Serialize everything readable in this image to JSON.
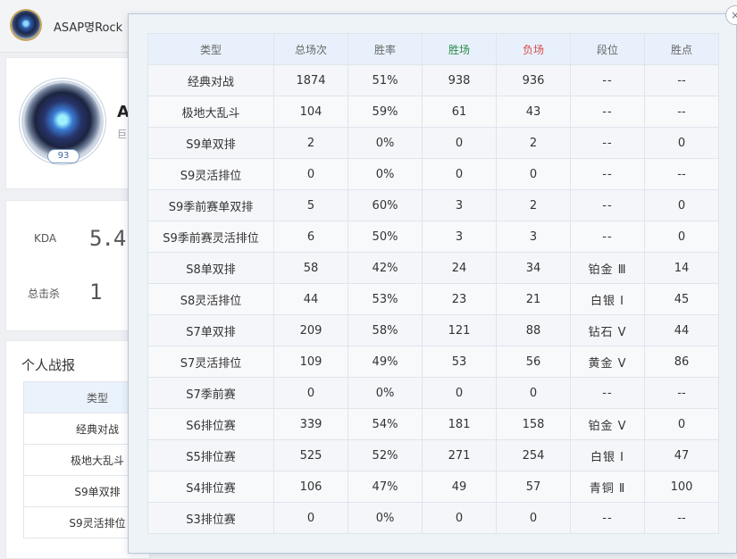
{
  "header": {
    "player_name": "ASAP명Rock"
  },
  "profile": {
    "level": "93",
    "name_initial": "A",
    "sub_initial": "巨"
  },
  "stats": {
    "kda_label": "KDA",
    "kda_value": "5.4",
    "kills_label": "总击杀",
    "kills_value": "1"
  },
  "report": {
    "title": "个人战报",
    "header": "类型",
    "rows": [
      "经典对战",
      "极地大乱斗",
      "S9单双排",
      "S9灵活排位"
    ]
  },
  "popup": {
    "close_label": "×",
    "columns": [
      "类型",
      "总场次",
      "胜率",
      "胜场",
      "负场",
      "段位",
      "胜点"
    ],
    "rows": [
      [
        "经典对战",
        "1874",
        "51%",
        "938",
        "936",
        "--",
        "--"
      ],
      [
        "极地大乱斗",
        "104",
        "59%",
        "61",
        "43",
        "--",
        "--"
      ],
      [
        "S9单双排",
        "2",
        "0%",
        "0",
        "2",
        "--",
        "0"
      ],
      [
        "S9灵活排位",
        "0",
        "0%",
        "0",
        "0",
        "--",
        "--"
      ],
      [
        "S9季前赛单双排",
        "5",
        "60%",
        "3",
        "2",
        "--",
        "0"
      ],
      [
        "S9季前赛灵活排位",
        "6",
        "50%",
        "3",
        "3",
        "--",
        "0"
      ],
      [
        "S8单双排",
        "58",
        "42%",
        "24",
        "34",
        "铂金 Ⅲ",
        "14"
      ],
      [
        "S8灵活排位",
        "44",
        "53%",
        "23",
        "21",
        "白银 Ⅰ",
        "45"
      ],
      [
        "S7单双排",
        "209",
        "58%",
        "121",
        "88",
        "钻石 Ⅴ",
        "44"
      ],
      [
        "S7灵活排位",
        "109",
        "49%",
        "53",
        "56",
        "黄金 Ⅴ",
        "86"
      ],
      [
        "S7季前赛",
        "0",
        "0%",
        "0",
        "0",
        "--",
        "--"
      ],
      [
        "S6排位赛",
        "339",
        "54%",
        "181",
        "158",
        "铂金 Ⅴ",
        "0"
      ],
      [
        "S5排位赛",
        "525",
        "52%",
        "271",
        "254",
        "白银 Ⅰ",
        "47"
      ],
      [
        "S4排位赛",
        "106",
        "47%",
        "49",
        "57",
        "青铜 Ⅱ",
        "100"
      ],
      [
        "S3排位赛",
        "0",
        "0%",
        "0",
        "0",
        "--",
        "--"
      ]
    ]
  },
  "colors": {
    "win": "#2c8a4b",
    "loss": "#d84b4b",
    "header_bg": "#e8f1fb"
  }
}
